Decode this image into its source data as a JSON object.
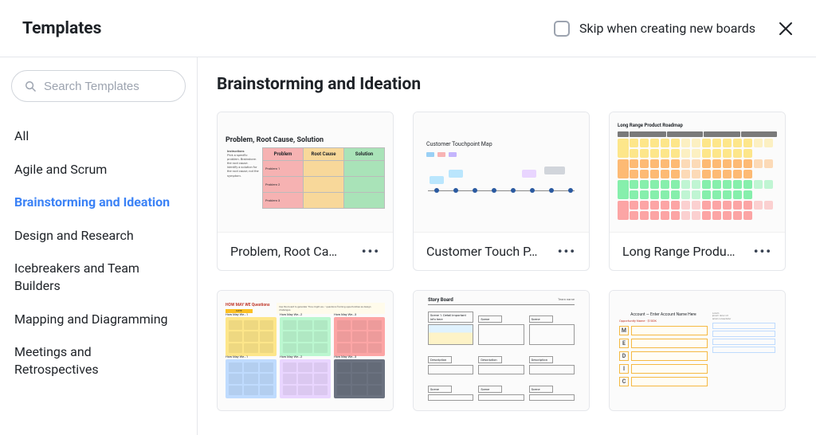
{
  "header": {
    "title": "Templates",
    "skip_label": "Skip when creating new boards"
  },
  "search": {
    "placeholder": "Search Templates"
  },
  "categories": [
    {
      "label": "All",
      "active": false
    },
    {
      "label": "Agile and Scrum",
      "active": false
    },
    {
      "label": "Brainstorming and Ideation",
      "active": true
    },
    {
      "label": "Design and Research",
      "active": false
    },
    {
      "label": "Icebreakers and Team Builders",
      "active": false
    },
    {
      "label": "Mapping and Diagramming",
      "active": false
    },
    {
      "label": "Meetings and Retrospectives",
      "active": false
    }
  ],
  "section_title": "Brainstorming and Ideation",
  "templates": [
    {
      "title": "Problem, Root Ca…",
      "full_title": "Problem, Root Cause, Solution"
    },
    {
      "title": "Customer Touch P…",
      "full_title": "Customer Touchpoint Map"
    },
    {
      "title": "Long Range Produ…",
      "full_title": "Long Range Product Roadmap"
    },
    {
      "title": "",
      "full_title": "HOW MAY WE Questions"
    },
    {
      "title": "",
      "full_title": "Story Board"
    },
    {
      "title": "",
      "full_title": "Account — Enter Account Name Here"
    }
  ],
  "thumb1": {
    "title": "Problem, Root Cause, Solution",
    "notes_hdr": "Instructions",
    "headers": [
      "Problem",
      "Root Cause",
      "Solution"
    ],
    "rows": [
      "Problem 1",
      "Problem 2",
      "Problem 3"
    ]
  },
  "thumb2": {
    "title": "Customer Touchpoint Map"
  },
  "thumb3": {
    "title": "Long Range Product Roadmap"
  },
  "thumb4": {
    "title": "HOW MAY WE Questions",
    "date": "DATE",
    "cells": [
      "How May We…1",
      "How May We…2",
      "How May We…3",
      "How May We…1",
      "How May We…2",
      "How May We…3"
    ]
  },
  "thumb5": {
    "title": "Story Board",
    "col_label_scene": "Scene",
    "col_label_desc": "Description",
    "team": "Team name"
  },
  "thumb6": {
    "title": "Account — Enter Account Name Here",
    "sub": "Opportunity Name · $100K",
    "letters": [
      "M",
      "E",
      "D",
      "I",
      "C"
    ]
  }
}
